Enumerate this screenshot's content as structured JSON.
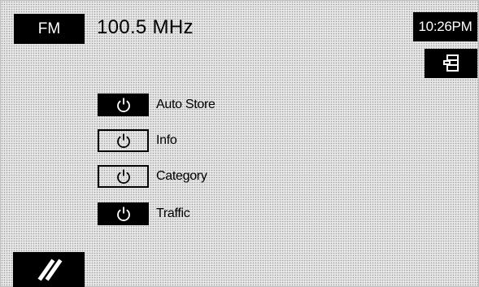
{
  "header": {
    "band_label": "FM",
    "frequency": "100.5 MHz",
    "clock": "10:26PM",
    "menu_icon": "menu-list-icon"
  },
  "options": [
    {
      "label": "Auto Store",
      "state": "on",
      "icon": "power-icon"
    },
    {
      "label": "Info",
      "state": "off",
      "icon": "power-icon"
    },
    {
      "label": "Category",
      "state": "off",
      "icon": "power-icon"
    },
    {
      "label": "Traffic",
      "state": "on",
      "icon": "power-icon"
    }
  ],
  "footer": {
    "back_icon": "back-slash-icon"
  },
  "colors": {
    "button": "#000000",
    "button_text": "#ffffff",
    "background": "#e7e7e7"
  }
}
